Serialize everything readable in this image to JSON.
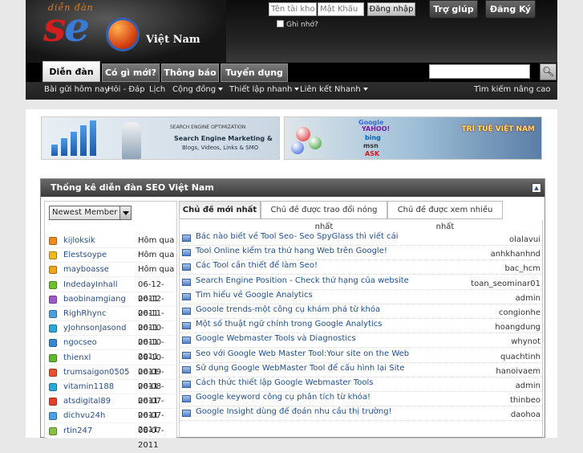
{
  "header": {
    "logo_small": "diễn đàn",
    "logo_big_1": "s",
    "logo_big_2": "e",
    "logo_big_3": "o",
    "logo_sub": "Việt Nam",
    "username_placeholder": "Tên tài khoả",
    "password_placeholder": "Mật Khẩu",
    "login_label": "Đăng nhập",
    "remember_label": "Ghi nhớ?",
    "help_label": "Trợ giúp",
    "register_label": "Đăng Ký"
  },
  "nav": {
    "tabs": [
      "Diễn đàn",
      "Có gì mới?",
      "Thông báo",
      "Tuyển dụng"
    ],
    "search_icon": "magnifier-icon"
  },
  "subnav": {
    "items": [
      "Bài gửi hôm nay",
      "Hỏi - Đáp",
      "Lịch",
      "Cộng đồng",
      "Thiết lập nhanh",
      "Liên kết Nhanh"
    ],
    "advanced_search": "Tìm kiếm nâng cao"
  },
  "banners": {
    "left_caption_1": "Search Engine Marketing &",
    "left_caption_2": "Blogs, Videos, Links & SMO",
    "left_title": "SEARCH ENGINE OPTIMIZATION",
    "right_engines": [
      "Google",
      "YAHOO!",
      "bing",
      "msn",
      "ASK"
    ],
    "right_text": "TRÍ TUỆ VIỆT NAM"
  },
  "panel": {
    "title": "Thống kê diễn đàn SEO Việt Nam",
    "select_value": "Newest Member",
    "tabs": [
      "Chủ đề mới nhất",
      "Chủ đề được trao đổi nóng nhất",
      "Chủ đề được xem nhiều nhất"
    ]
  },
  "members": [
    {
      "name": "kijloksik",
      "date": "Hôm qua",
      "color": "#f08a1c"
    },
    {
      "name": "Elestsoype",
      "date": "Hôm qua",
      "color": "#f0b81c"
    },
    {
      "name": "mayboasse",
      "date": "Hôm qua",
      "color": "#f0a31c"
    },
    {
      "name": "IndedayInhall",
      "date": "06-12-2011",
      "color": "#6cbf2c"
    },
    {
      "name": "baobinamgiang",
      "date": "06-12-2011",
      "color": "#a05ac8"
    },
    {
      "name": "RighRhync",
      "date": "06-11-2011",
      "color": "#4aa0e0"
    },
    {
      "name": "yJohnsonJasond",
      "date": "06-10-2011",
      "color": "#2aa8d8"
    },
    {
      "name": "ngocseo",
      "date": "06-10-2011",
      "color": "#3a86d4"
    },
    {
      "name": "thienxl",
      "date": "06-10-2011",
      "color": "#60b830"
    },
    {
      "name": "trumsaigon0505",
      "date": "06-09-2011",
      "color": "#e85030"
    },
    {
      "name": "vitamin1188",
      "date": "06-08-2011",
      "color": "#2aa8d8"
    },
    {
      "name": "atsdigital89",
      "date": "06-07-2011",
      "color": "#e83c2c"
    },
    {
      "name": "dichvu24h",
      "date": "06-07-2011",
      "color": "#4aa0e0"
    },
    {
      "name": "rtin247",
      "date": "06-07-2011",
      "color": "#86c040"
    }
  ],
  "threads": [
    {
      "title": "Bác nào biết về Tool Seo- Seo SpyGlass thì viết cái",
      "author": "olalavui"
    },
    {
      "title": "Tool Online kiểm tra thứ hạng Web trên Google!",
      "author": "anhkhanhnd"
    },
    {
      "title": "Các Tool cần thiết để làm Seo!",
      "author": "bac_hcm"
    },
    {
      "title": "Search Engine Position - Check thứ hạng của website",
      "author": "toan_seominar01"
    },
    {
      "title": "Tìm hiểu về Google Analytics",
      "author": "admin"
    },
    {
      "title": "Gooole trends-một công cụ khám phá từ khóa",
      "author": "congionhe"
    },
    {
      "title": "Một số thuật ngữ chính trong Google Analytics",
      "author": "hoangdung"
    },
    {
      "title": "Google Webmaster Tools và Diagnostics",
      "author": "whynot"
    },
    {
      "title": "Seo với Google Web Master Tool:Your site on the Web",
      "author": "quachtinh"
    },
    {
      "title": "Sử dụng Google WebMaster Tool để cấu hình lại Site",
      "author": "hanoivaem"
    },
    {
      "title": "Cách thức thiết lập Google Webmaster Tools",
      "author": "admin"
    },
    {
      "title": "Google keyword công cụ phân tích từ khóa!",
      "author": "thinbeo"
    },
    {
      "title": "Google Insight dùng để đoán nhu cầu thị trường!",
      "author": "daohoa"
    }
  ]
}
